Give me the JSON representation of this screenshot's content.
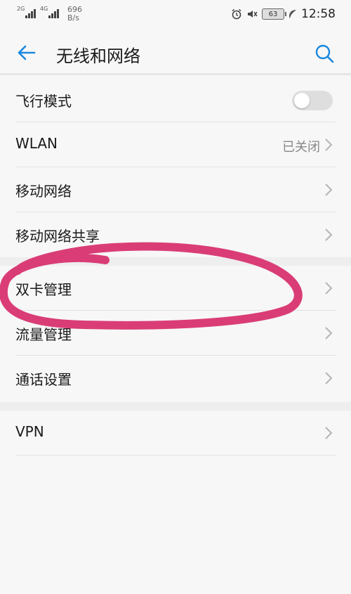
{
  "status_bar": {
    "sim1_tag": "2G",
    "sim2_tag": "4G",
    "net_speed": "696",
    "net_speed_unit": "B/s",
    "battery": "63",
    "time": "12:58",
    "icons": [
      "alarm-icon",
      "mute-icon",
      "battery-icon",
      "leaf-icon"
    ]
  },
  "header": {
    "title": "无线和网络",
    "back_icon": "arrow-left-icon",
    "search_icon": "search-icon",
    "accent_color": "#1a88e0"
  },
  "rows": [
    {
      "label": "飞行模式",
      "control": "toggle",
      "state": "off"
    },
    {
      "label": "WLAN",
      "value": "已关闭"
    },
    {
      "label": "移动网络"
    },
    {
      "label": "移动网络共享"
    },
    {
      "label": "双卡管理"
    },
    {
      "label": "流量管理"
    },
    {
      "label": "通话设置"
    },
    {
      "label": "VPN"
    }
  ],
  "annotation": {
    "shape": "hand-drawn ellipse",
    "color": "#d8336f",
    "target": "双卡管理"
  }
}
